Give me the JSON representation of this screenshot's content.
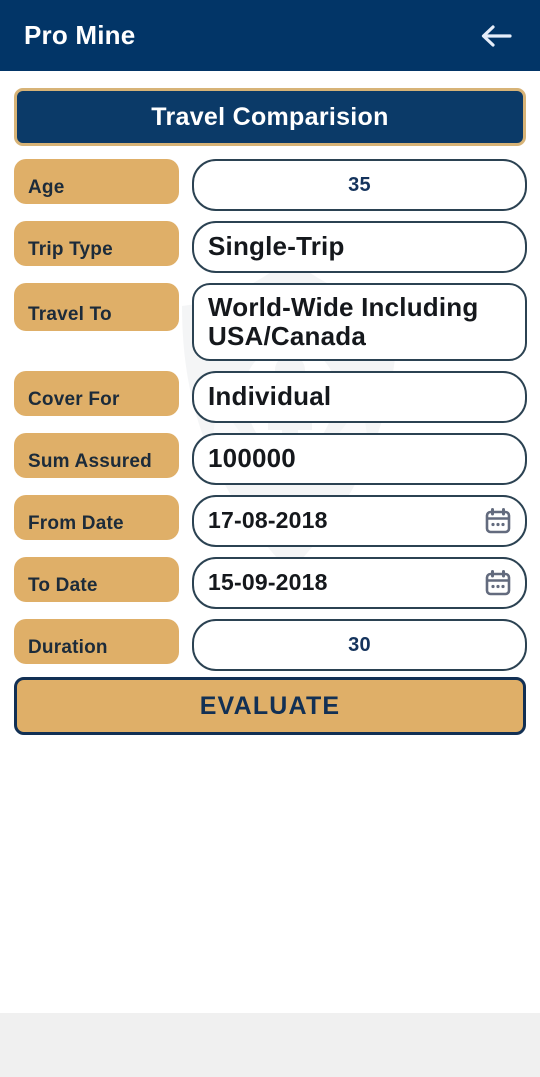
{
  "appbar": {
    "title": "Pro Mine",
    "back_icon": "arrow-left-icon"
  },
  "section": {
    "title": "Travel Comparision"
  },
  "form": {
    "rows": [
      {
        "label": "Age",
        "value": "35",
        "align": "center",
        "icon": null,
        "lines": 1,
        "size": "normal"
      },
      {
        "label": "Trip Type",
        "value": "Single-Trip",
        "align": "left",
        "icon": null,
        "lines": 1,
        "size": "normal"
      },
      {
        "label": "Travel To",
        "value": "World-Wide Including USA/Canada",
        "align": "left",
        "icon": null,
        "lines": 2,
        "size": "normal"
      },
      {
        "label": "Cover For",
        "value": "Individual",
        "align": "left",
        "icon": null,
        "lines": 1,
        "size": "normal"
      },
      {
        "label": "Sum Assured",
        "value": "100000",
        "align": "left",
        "icon": null,
        "lines": 1,
        "size": "normal"
      },
      {
        "label": "From Date",
        "value": "17-08-2018",
        "align": "left",
        "icon": "calendar-icon",
        "lines": 1,
        "size": "small"
      },
      {
        "label": "To Date",
        "value": "15-09-2018",
        "align": "left",
        "icon": "calendar-icon",
        "lines": 1,
        "size": "small"
      },
      {
        "label": "Duration",
        "value": "30",
        "align": "center",
        "icon": null,
        "lines": 1,
        "size": "normal"
      }
    ]
  },
  "actions": {
    "evaluate_label": "EVALUATE"
  },
  "colors": {
    "navy": "#023567",
    "gold": "#dfaf68",
    "title_bar_bg": "#0b3a68",
    "title_bar_border": "#d7b377",
    "field_border": "#2b4252",
    "value_text": "#15181c",
    "centered_value_text": "#14335c",
    "calendar_icon": "#636b7e",
    "bottom_strip": "#f0f0f0"
  }
}
